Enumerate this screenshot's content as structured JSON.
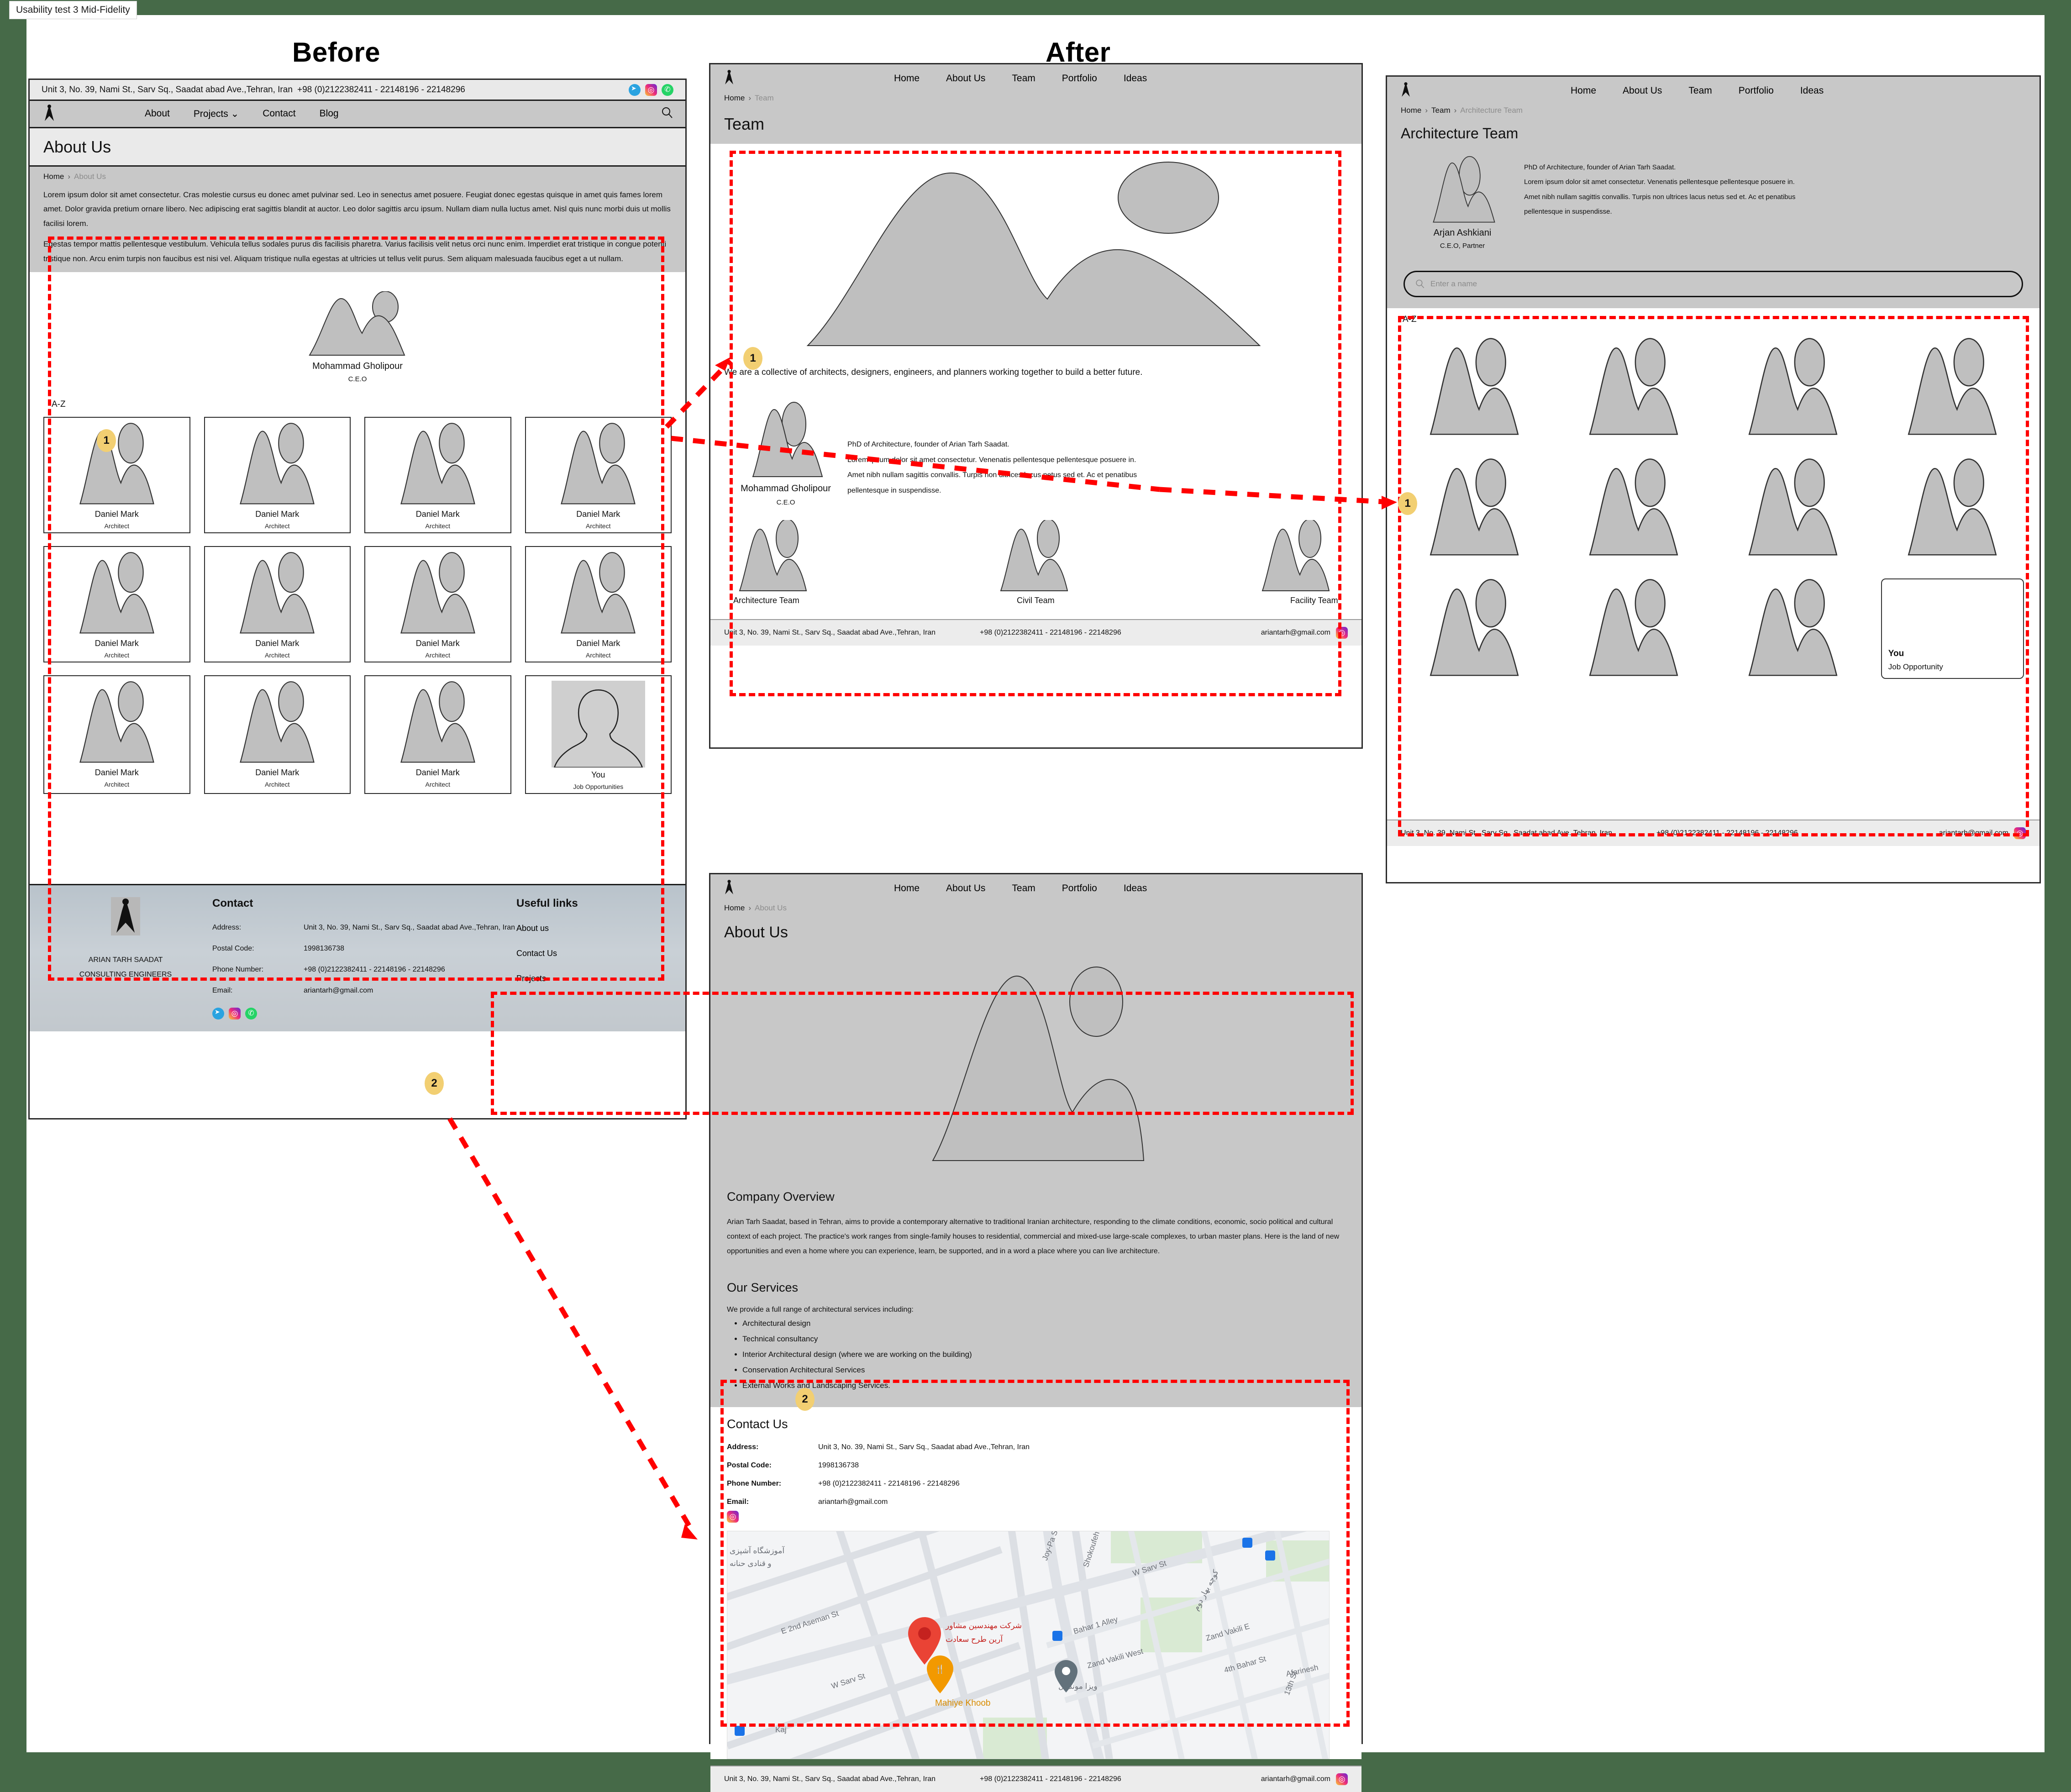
{
  "file_tab": "Usability test 3 Mid-Fidelity",
  "section_labels": {
    "before": "Before",
    "after": "After"
  },
  "brand": {
    "company_line1": "ARIAN TARH SAADAT",
    "company_line2": "CONSULTING ENGINEERS",
    "address": "Unit 3, No. 39, Nami St., Sarv Sq., Saadat abad Ave.,Tehran, Iran",
    "phone": "+98 (0)2122382411 - 22148196 - 22148296",
    "postal_code": "1998136738",
    "email": "ariantarh@gmail.com"
  },
  "annotations": {
    "one": "1",
    "two": "2"
  },
  "before_page": {
    "nav": {
      "items": [
        "About",
        "Projects",
        "Contact",
        "Blog"
      ],
      "dropdown_caret": "⌄",
      "search_icon": "search-icon"
    },
    "page_title": "About Us",
    "breadcrumb": {
      "home": "Home",
      "sep": "›",
      "current": "About Us"
    },
    "paragraph_1": "Lorem ipsum dolor sit amet consectetur. Cras molestie cursus eu donec amet pulvinar sed. Leo in senectus amet posuere. Feugiat donec egestas quisque in amet quis fames lorem amet. Dolor gravida pretium ornare libero. Nec adipiscing erat sagittis blandit at auctor. Leo dolor sagittis arcu ipsum. Nullam diam nulla luctus amet. Nisl quis nunc morbi duis ut mollis facilisi lorem.",
    "paragraph_2": "Egestas tempor mattis pellentesque vestibulum. Vehicula tellus sodales purus dis facilisis pharetra. Varius facilisis velit netus orci nunc enim. Imperdiet erat tristique in congue potenti tristique non. Arcu enim turpis non faucibus est nisi vel. Aliquam tristique nulla egestas at ultricies ut tellus velit purus. Sem aliquam malesuada faucibus eget a ut nullam.",
    "ceo": {
      "name": "Mohammad Gholipour",
      "role": "C.E.O"
    },
    "az_label": "A-Z",
    "people": [
      {
        "name": "Daniel Mark",
        "role": "Architect"
      },
      {
        "name": "Daniel Mark",
        "role": "Architect"
      },
      {
        "name": "Daniel Mark",
        "role": "Architect"
      },
      {
        "name": "Daniel Mark",
        "role": "Architect"
      },
      {
        "name": "Daniel Mark",
        "role": "Architect"
      },
      {
        "name": "Daniel Mark",
        "role": "Architect"
      },
      {
        "name": "Daniel Mark",
        "role": "Architect"
      },
      {
        "name": "Daniel Mark",
        "role": "Architect"
      },
      {
        "name": "Daniel Mark",
        "role": "Architect"
      },
      {
        "name": "Daniel Mark",
        "role": "Architect"
      },
      {
        "name": "Daniel Mark",
        "role": "Architect"
      },
      {
        "name": "You",
        "role": "Job Opportunities"
      }
    ],
    "footer": {
      "contact_heading": "Contact",
      "useful_heading": "Useful links",
      "labels": {
        "address": "Address:",
        "postal": "Postal Code:",
        "phone": "Phone Number:",
        "email": "Email:"
      },
      "links": [
        "About us",
        "Contact Us",
        "Projects"
      ]
    }
  },
  "after_nav": {
    "items": [
      "Home",
      "About Us",
      "Team",
      "Portfolio",
      "Ideas"
    ]
  },
  "team_page": {
    "breadcrumb": {
      "home": "Home",
      "sep": "›",
      "current": "Team"
    },
    "page_title": "Team",
    "tagline": "We are a collective of architects, designers, engineers, and planners working together to build a better future.",
    "ceo": {
      "name": "Mohammad Gholipour",
      "role": "C.E.O"
    },
    "ceo_bio": [
      "PhD of Architecture, founder of Arian Tarh Saadat.",
      "Lorem ipsum dolor sit amet consectetur. Venenatis pellentesque pellentesque posuere in.",
      "Amet nibh nullam sagittis convallis. Turpis non ultrices lacus netus sed et. Ac et penatibus",
      " pellentesque in suspendisse."
    ],
    "teams": [
      "Architecture Team",
      "Civil Team",
      "Facility Team"
    ]
  },
  "architecture_page": {
    "breadcrumb": {
      "home": "Home",
      "sep": "›",
      "mid": "Team",
      "current": "Architecture Team"
    },
    "page_title": "Architecture Team",
    "lead": {
      "name": "Arjan Ashkiani",
      "role": "C.E.O, Partner"
    },
    "lead_bio": [
      "PhD of Architecture, founder of Arian Tarh Saadat.",
      "Lorem ipsum dolor sit amet consectetur. Venenatis pellentesque pellentesque posuere in.",
      "Amet nibh nullam sagittis convallis. Turpis non ultrices lacus netus sed et. Ac et penatibus",
      "pellentesque in suspendisse."
    ],
    "search_placeholder": "Enter a name",
    "az_label": "A-Z",
    "grid_count": 11,
    "job_card": {
      "name": "You",
      "role": "Job Opportunity"
    }
  },
  "about_page": {
    "breadcrumb": {
      "home": "Home",
      "sep": "›",
      "current": "About Us"
    },
    "page_title": "About Us",
    "overview_heading": "Company Overview",
    "overview_text": "Arian Tarh Saadat, based in Tehran, aims to provide a contemporary alternative to traditional Iranian architecture, responding to the climate conditions, economic, socio political and cultural context of each project. The practice's work ranges from single-family houses to residential, commercial and mixed-use large-scale complexes, to urban master plans. Here is the land of new opportunities and even a home where you can experience, learn, be supported, and in a word a place where you can live architecture.",
    "services_heading": "Our Services",
    "services_intro": "We provide a full range of architectural services including:",
    "services": [
      "Architectural design",
      "Technical consultancy",
      "Interior Architectural design (where we are working on the building)",
      "Conservation Architectural Services",
      "External Works and Landscaping Services."
    ],
    "contact_heading": "Contact Us",
    "labels": {
      "address": "Address:",
      "postal": "Postal Code:",
      "phone": "Phone Number:",
      "email": "Email:"
    },
    "map": {
      "pin_main_label": "شرکت مهندسین مشاور آرین طرح سعادت",
      "pin_food_label": "Mahiye Khoob",
      "streets": [
        "Joy-Pa St",
        "Shokoufeh St",
        "W Sarv St",
        "E 2nd Aseman St",
        "Bahar 1 Alley",
        "Zand Vakili West",
        "Zand Vakili E",
        "4th Bahar St",
        "13th St",
        "Afarinesh",
        "Kaj",
        "W Sarv St",
        "کوچه بهار دوم",
        "آموزشگاه آشپزی و قنادی حنانه",
        "ویزا موندیال"
      ]
    }
  }
}
